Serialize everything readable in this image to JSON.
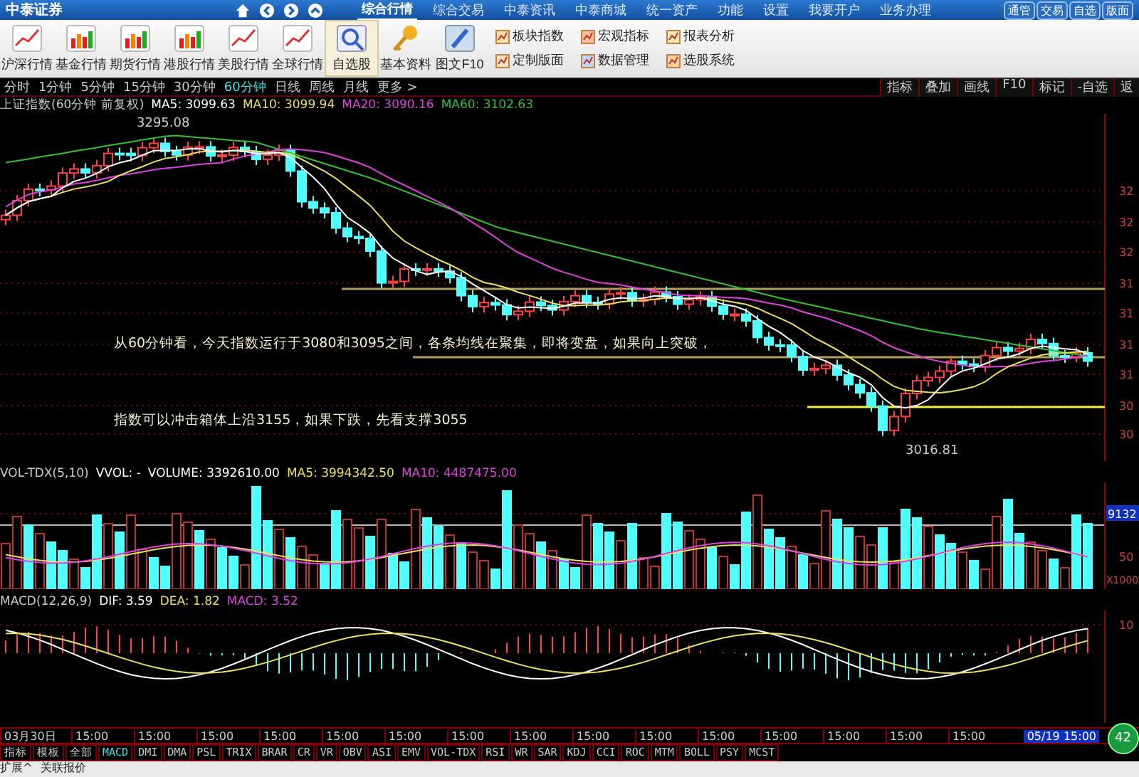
{
  "top_bar": {
    "logo": "中泰证券",
    "menu": [
      {
        "label": "综合行情",
        "selected": true
      },
      {
        "label": "综合交易",
        "selected": false
      },
      {
        "label": "中泰资讯",
        "selected": false
      },
      {
        "label": "中泰商城",
        "selected": false
      },
      {
        "label": "统一资产",
        "selected": false
      },
      {
        "label": "功能",
        "selected": false
      },
      {
        "label": "设置",
        "selected": false
      },
      {
        "label": "我要开户",
        "selected": false
      },
      {
        "label": "业务办理",
        "selected": false
      }
    ],
    "quick_buttons": [
      "通管",
      "交易",
      "自选",
      "版面"
    ]
  },
  "toolbar": {
    "big_buttons": [
      {
        "label": "沪深行情",
        "selected": false
      },
      {
        "label": "基金行情",
        "selected": false
      },
      {
        "label": "期货行情",
        "selected": false
      },
      {
        "label": "港股行情",
        "selected": false
      },
      {
        "label": "美股行情",
        "selected": false
      },
      {
        "label": "全球行情",
        "selected": false
      },
      {
        "label": "自选股",
        "selected": true
      },
      {
        "label": "基本资料",
        "selected": false
      },
      {
        "label": "图文F10",
        "selected": false
      }
    ],
    "small_buttons": [
      "板块指数",
      "宏观指标",
      "报表分析",
      "定制版面",
      "数据管理",
      "选股系统"
    ]
  },
  "period_bar": {
    "periods": [
      {
        "label": "分时",
        "selected": false
      },
      {
        "label": "1分钟",
        "selected": false
      },
      {
        "label": "5分钟",
        "selected": false
      },
      {
        "label": "15分钟",
        "selected": false
      },
      {
        "label": "30分钟",
        "selected": false
      },
      {
        "label": "60分钟",
        "selected": true
      },
      {
        "label": "日线",
        "selected": false
      },
      {
        "label": "周线",
        "selected": false
      },
      {
        "label": "月线",
        "selected": false
      },
      {
        "label": "更多 >",
        "selected": false
      }
    ],
    "tools": [
      "指标",
      "叠加",
      "画线",
      "F10",
      "标记",
      "-自选",
      "返"
    ]
  },
  "price_chart": {
    "title": "上证指数(60分钟 前复权)",
    "legend": [
      {
        "text": "MA5: 3099.63",
        "color": "#ffffff"
      },
      {
        "text": "MA10: 3099.94",
        "color": "#e8e060"
      },
      {
        "text": "MA20: 3090.16",
        "color": "#e040e0"
      },
      {
        "text": "MA60: 3102.63",
        "color": "#30c030"
      }
    ],
    "high_label": "3295.08",
    "low_label": "3016.81",
    "note_lines": [
      "从60分钟看，今天指数运行于3080和3095之间，各条均线在聚集，即将变盘，如果向上突破，",
      "指数可以冲击箱体上沿3155，如果下跌，先看支撑3055"
    ],
    "axis_labels": [
      "32",
      "32",
      "32",
      "31",
      "31",
      "31",
      "31",
      "30",
      "30"
    ]
  },
  "volume_chart": {
    "title": "VOL-TDX(5,10)",
    "legend": [
      {
        "text": "VVOL: -",
        "color": "#ffffff"
      },
      {
        "text": "VOLUME: 3392610.00",
        "color": "#ffffff"
      },
      {
        "text": "MA5: 3994342.50",
        "color": "#e8e060"
      },
      {
        "text": "MA10: 4487475.00",
        "color": "#e040e0"
      }
    ],
    "axis_labels": [
      "9132",
      "50",
      "X1000"
    ]
  },
  "macd_chart": {
    "title": "MACD(12,26,9)",
    "legend": [
      {
        "text": "DIF: 3.59",
        "color": "#ffffff"
      },
      {
        "text": "DEA: 1.82",
        "color": "#e8e060"
      },
      {
        "text": "MACD: 3.52",
        "color": "#e040e0"
      }
    ],
    "axis_labels": [
      "10"
    ]
  },
  "time_axis": {
    "start": "03月30日",
    "ticks": [
      "15:00",
      "15:00",
      "15:00",
      "15:00",
      "15:00",
      "15:00",
      "15:00",
      "15:00",
      "15:00",
      "15:00",
      "15:00",
      "15:00",
      "15:00",
      "15:00",
      "15:00"
    ],
    "cursor": "05/19 15:00",
    "gauge": "42"
  },
  "indicator_tabs": [
    {
      "label": "指标",
      "selected": false
    },
    {
      "label": "模板",
      "selected": false
    },
    {
      "label": "全部",
      "selected": false
    },
    {
      "label": "MACD",
      "selected": true
    },
    {
      "label": "DMI",
      "selected": false
    },
    {
      "label": "DMA",
      "selected": false
    },
    {
      "label": "PSL",
      "selected": false
    },
    {
      "label": "TRIX",
      "selected": false
    },
    {
      "label": "BRAR",
      "selected": false
    },
    {
      "label": "CR",
      "selected": false
    },
    {
      "label": "VR",
      "selected": false
    },
    {
      "label": "OBV",
      "selected": false
    },
    {
      "label": "ASI",
      "selected": false
    },
    {
      "label": "EMV",
      "selected": false
    },
    {
      "label": "VOL-TDX",
      "selected": false
    },
    {
      "label": "RSI",
      "selected": false
    },
    {
      "label": "WR",
      "selected": false
    },
    {
      "label": "SAR",
      "selected": false
    },
    {
      "label": "KDJ",
      "selected": false
    },
    {
      "label": "CCI",
      "selected": false
    },
    {
      "label": "ROC",
      "selected": false
    },
    {
      "label": "MTM",
      "selected": false
    },
    {
      "label": "BOLL",
      "selected": false
    },
    {
      "label": "PSY",
      "selected": false
    },
    {
      "label": "MCST",
      "selected": false
    }
  ],
  "bottom_bar": [
    "扩展^",
    "关联报价"
  ]
}
